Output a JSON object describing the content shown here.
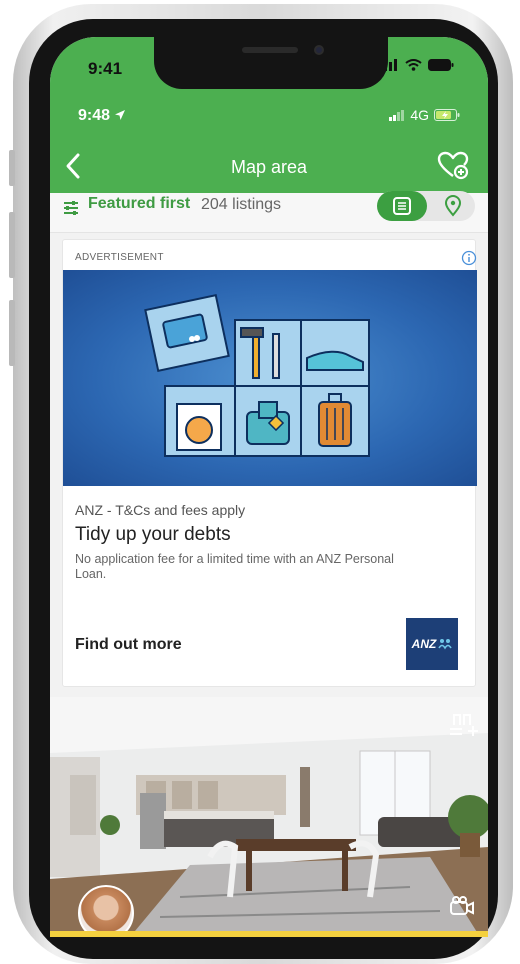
{
  "device": {
    "time": "9:41"
  },
  "app_status": {
    "time": "9:48",
    "network": "4G"
  },
  "nav": {
    "title": "Map area"
  },
  "filter": {
    "featured_label": "Featured first",
    "count_label": "204 listings"
  },
  "ad": {
    "label": "ADVERTISEMENT",
    "advertiser": "ANZ - T&Cs and fees apply",
    "title": "Tidy up your debts",
    "description": "No application fee for a limited time with an ANZ Personal Loan.",
    "cta": "Find out more",
    "logo_text": "ANZ"
  },
  "colors": {
    "brand_green": "#4caf50",
    "accent_green": "#3c9f41",
    "anz_navy": "#1d3f77",
    "agent_bar_yellow": "#f4d03f"
  },
  "icons": [
    "back-chevron-icon",
    "heart-add-icon",
    "filter-sliders-icon",
    "list-view-icon",
    "map-pin-icon",
    "info-icon",
    "shortlist-add-icon",
    "video-tour-icon"
  ]
}
